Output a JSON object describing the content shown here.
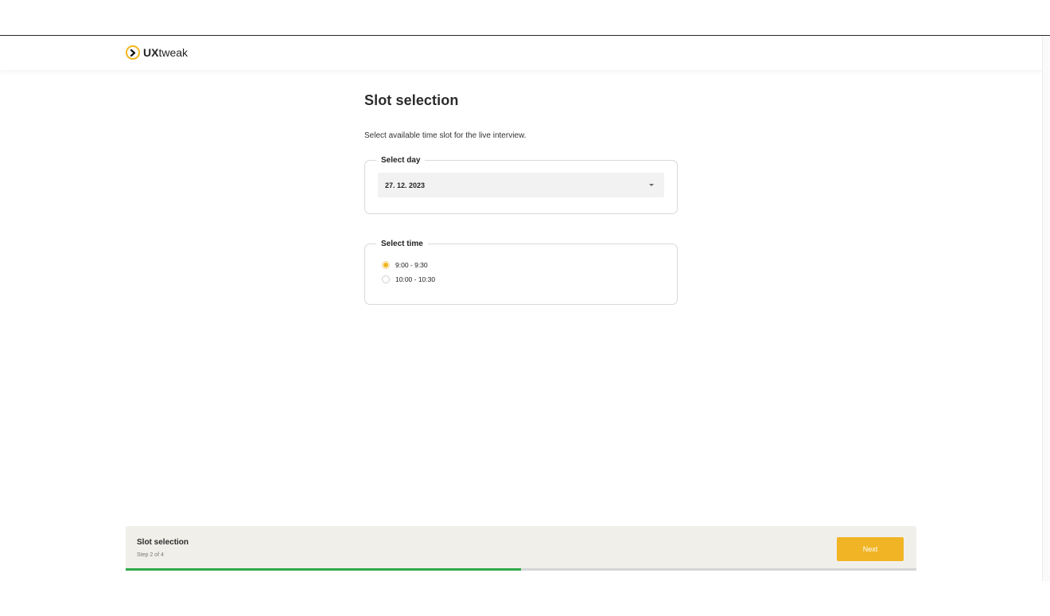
{
  "brand": {
    "name_bold": "UX",
    "name_regular": "tweak",
    "accent_color": "#f2b51c"
  },
  "page": {
    "title": "Slot selection",
    "description": "Select available time slot for the live interview."
  },
  "day_field": {
    "legend": "Select day",
    "selected_value": "27. 12. 2023"
  },
  "time_field": {
    "legend": "Select time",
    "options": [
      {
        "label": "9:00 - 9:30",
        "checked": true
      },
      {
        "label": "10:00 - 10:30",
        "checked": false
      }
    ]
  },
  "footer": {
    "title": "Slot selection",
    "step_text": "Step 2 of 4",
    "next_label": "Next",
    "progress_fraction": 0.5,
    "progress_color": "#2eaa4a",
    "button_color": "#f0b424"
  }
}
